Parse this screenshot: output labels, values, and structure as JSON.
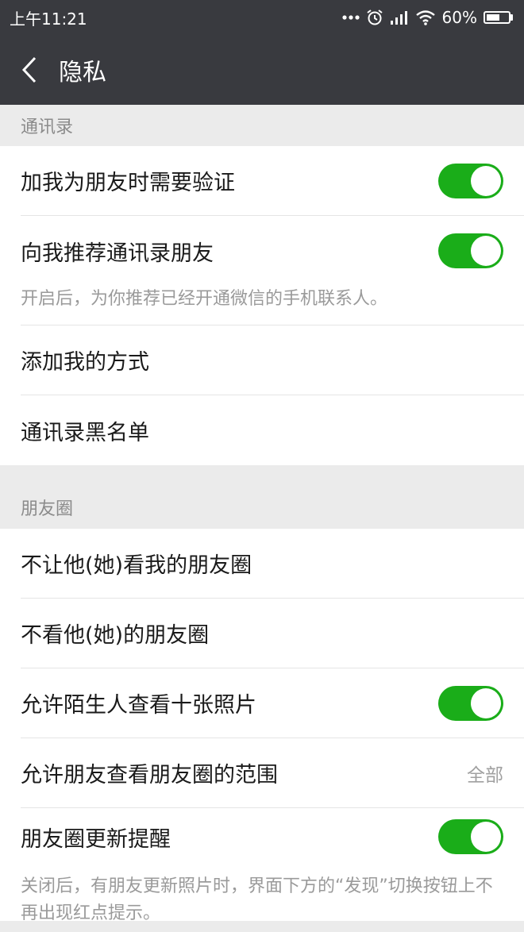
{
  "status_bar": {
    "time": "上午11:21",
    "battery_text": "60%",
    "battery_level": 0.6,
    "icons": [
      "more-dots-icon",
      "alarm-icon",
      "signal-icon",
      "wifi-icon",
      "battery-icon"
    ]
  },
  "nav": {
    "back_icon": "chevron-left-icon",
    "title": "隐私"
  },
  "contacts_section": {
    "header": "通讯录",
    "verify_label": "加我为朋友时需要验证",
    "verify_on": true,
    "recommend_label": "向我推荐通讯录朋友",
    "recommend_on": true,
    "recommend_desc": "开启后，为你推荐已经开通微信的手机联系人。",
    "add_methods_label": "添加我的方式",
    "blacklist_label": "通讯录黑名单"
  },
  "moments_section": {
    "header": "朋友圈",
    "hide_my_moments_label": "不让他(她)看我的朋友圈",
    "hide_their_moments_label": "不看他(她)的朋友圈",
    "stranger_photos_label": "允许陌生人查看十张照片",
    "stranger_photos_on": true,
    "range_label": "允许朋友查看朋友圈的范围",
    "range_value": "全部",
    "update_reminder_label": "朋友圈更新提醒",
    "update_reminder_on": true,
    "update_reminder_desc": "关闭后，有朋友更新照片时，界面下方的“发现”切换按钮上不再出现红点提示。"
  },
  "colors": {
    "header_bg": "#393a3f",
    "toggle_on": "#1aad19",
    "page_bg": "#ebebeb",
    "secondary_text": "#9a9a9a"
  }
}
